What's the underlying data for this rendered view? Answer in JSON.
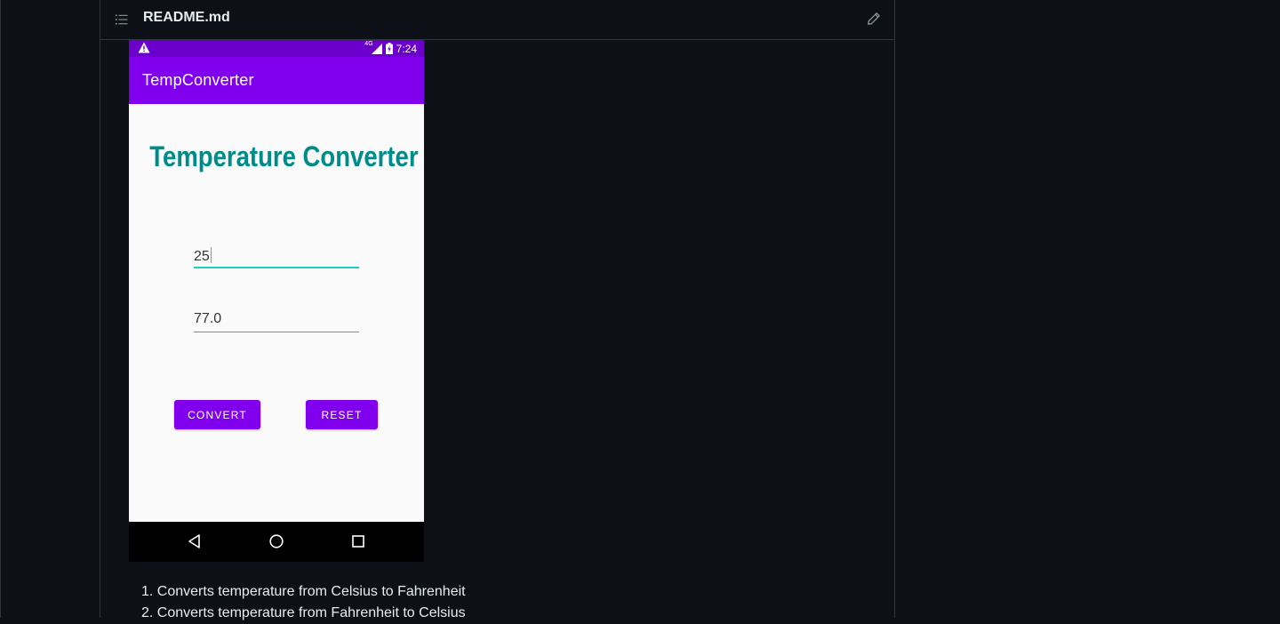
{
  "readme": {
    "filename": "README.md",
    "toc_icon": "list-unordered-icon",
    "edit_icon": "pencil-icon"
  },
  "phone": {
    "status_bar": {
      "warning_icon": "warning-icon",
      "network": "4G",
      "signal_icon": "signal-icon",
      "battery_icon": "battery-charging-icon",
      "time": "7:24"
    },
    "app_bar_title": "TempConverter",
    "heading": "Temperature Converter",
    "input_value": "25",
    "output_value": "77.0",
    "convert_label": "CONVERT",
    "reset_label": "RESET",
    "nav": {
      "back_icon": "back-triangle-icon",
      "home_icon": "home-circle-icon",
      "recent_icon": "recents-square-icon"
    },
    "colors": {
      "primary": "#8000ee",
      "primary_dark": "#6a00c9",
      "heading": "#008b8b",
      "accent": "#1ecbc0"
    }
  },
  "features": [
    "1. Converts temperature from Celsius to Fahrenheit",
    "2. Converts temperature from Fahrenheit to Celsius"
  ]
}
